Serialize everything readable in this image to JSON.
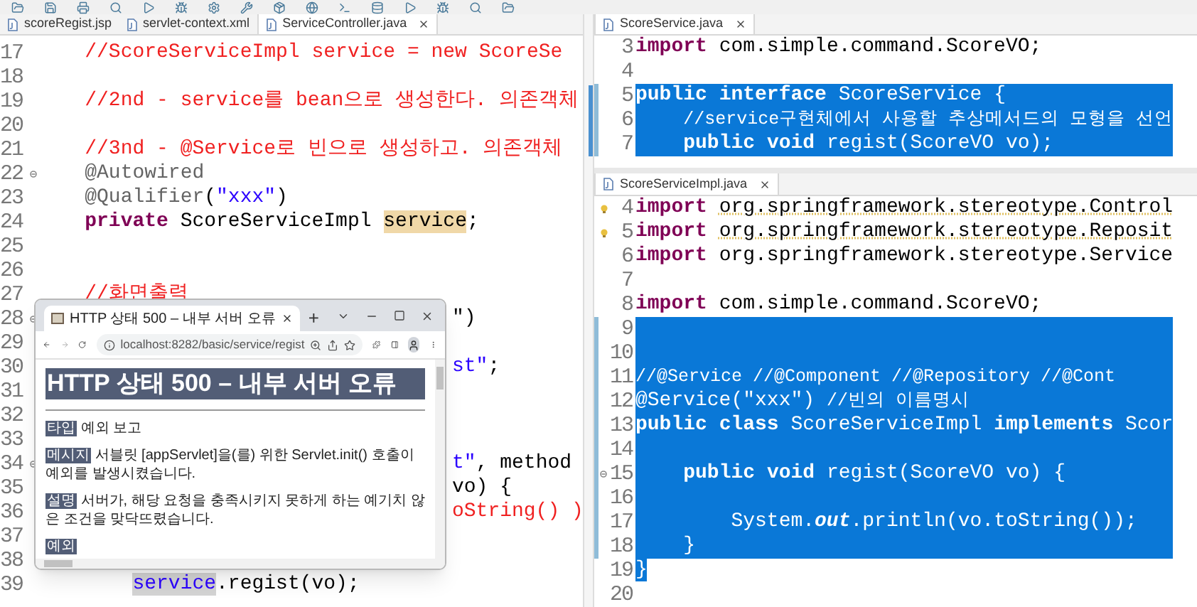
{
  "left_editor": {
    "tabs": [
      {
        "label": "scoreRegist.jsp",
        "selected": false
      },
      {
        "label": "servlet-context.xml",
        "selected": false
      },
      {
        "label": "ServiceController.java",
        "selected": true
      }
    ],
    "lines": [
      {
        "number": "17",
        "kind": "code",
        "occluded": false,
        "segments": [
          {
            "kind": "comment",
            "text": "    //ScoreServiceImpl service = new ScoreSe"
          }
        ]
      },
      {
        "number": "18",
        "kind": "code"
      },
      {
        "number": "19",
        "kind": "code",
        "occluded": false,
        "segments": [
          {
            "kind": "comment",
            "text": "    //2nd - service를 bean으로 생성한다. 의존객체"
          }
        ]
      },
      {
        "number": "20",
        "kind": "code"
      },
      {
        "number": "21",
        "kind": "code",
        "occluded": false,
        "segments": [
          {
            "kind": "comment",
            "text": "    //3nd - @Service로 빈으로 생성하고. 의존객체"
          }
        ]
      },
      {
        "number": "22",
        "kind": "fold",
        "occluded": false,
        "segments": [
          {
            "kind": "annotation",
            "text": "    @Autowired"
          }
        ]
      },
      {
        "number": "23",
        "kind": "code",
        "occluded": false,
        "segments": [
          {
            "kind": "annotation",
            "text": "    @Qualifier"
          },
          {
            "kind": "plain",
            "text": "("
          },
          {
            "kind": "string",
            "text": "\"xxx\""
          },
          {
            "kind": "plain",
            "text": ")"
          }
        ]
      },
      {
        "number": "24",
        "kind": "code",
        "occluded": false,
        "segments": [
          {
            "kind": "keyword",
            "text": "    private"
          },
          {
            "kind": "plain",
            "text": " ScoreServiceImpl "
          },
          {
            "kind": "occurrence",
            "text": "service"
          },
          {
            "kind": "plain",
            "text": ";"
          }
        ]
      },
      {
        "number": "25",
        "kind": "code"
      },
      {
        "number": "26",
        "kind": "code"
      },
      {
        "number": "27",
        "kind": "code",
        "occluded": false,
        "segments": [
          {
            "kind": "comment",
            "text": "    //화면출력"
          }
        ]
      },
      {
        "number": "28",
        "kind": "fold",
        "occluded": true,
        "segments": [
          {
            "kind": "plain",
            "text": "\")"
          }
        ]
      },
      {
        "number": "29",
        "kind": "code"
      },
      {
        "number": "30",
        "kind": "code",
        "occluded": true,
        "segments": [
          {
            "kind": "string",
            "text": "st\""
          },
          {
            "kind": "plain",
            "text": ";"
          }
        ]
      },
      {
        "number": "31",
        "kind": "code"
      },
      {
        "number": "32",
        "kind": "code"
      },
      {
        "number": "33",
        "kind": "code"
      },
      {
        "number": "34",
        "kind": "fold",
        "occluded": true,
        "segments": [
          {
            "kind": "string",
            "text": "t\""
          },
          {
            "kind": "plain",
            "text": ", method"
          }
        ]
      },
      {
        "number": "35",
        "kind": "code",
        "occluded": true,
        "segments": [
          {
            "kind": "plain",
            "text": "vo) {"
          }
        ]
      },
      {
        "number": "36",
        "kind": "code",
        "occluded": true,
        "segments": [
          {
            "kind": "comment",
            "text": "oString() )"
          }
        ]
      },
      {
        "number": "37",
        "kind": "code"
      },
      {
        "number": "38",
        "kind": "code"
      },
      {
        "number": "39",
        "kind": "code",
        "occluded": false,
        "segments": [
          {
            "kind": "reference",
            "text": "        service"
          },
          {
            "kind": "plain",
            "text": ".regist(vo);"
          }
        ]
      }
    ]
  },
  "right_top": {
    "tabs": [
      {
        "label": "ScoreService.java",
        "selected": true
      }
    ],
    "lines": [
      {
        "number": "3",
        "selected": false,
        "segments": [
          {
            "kind": "keyword",
            "text": "import"
          },
          {
            "kind": "plain",
            "text": " com.simple.command.ScoreVO;"
          }
        ]
      },
      {
        "number": "4",
        "selected": false
      },
      {
        "number": "5",
        "selected": true,
        "segments": [
          {
            "kind": "keyword",
            "text": "public"
          },
          {
            "kind": "keyword",
            "text": " interface"
          },
          {
            "kind": "plain",
            "text": " ScoreService {"
          }
        ]
      },
      {
        "number": "6",
        "selected": true,
        "segments": [
          {
            "kind": "comment",
            "text": "    //service구현체에서 사용할 추상메서드의 모형을 선언"
          }
        ]
      },
      {
        "number": "7",
        "selected": true,
        "segments": [
          {
            "kind": "keyword",
            "text": "    public"
          },
          {
            "kind": "keyword",
            "text": " void"
          },
          {
            "kind": "plain",
            "text": " regist(ScoreVO vo);"
          }
        ]
      }
    ]
  },
  "right_bottom": {
    "tabs": [
      {
        "label": "ScoreServiceImpl.java",
        "selected": true
      }
    ],
    "lines": [
      {
        "number": "4",
        "kind": "warning",
        "selected": false,
        "segments": [
          {
            "kind": "keyword",
            "text": "import"
          },
          {
            "kind": "warning",
            "text": " org.springframework.stereotype.Control"
          }
        ]
      },
      {
        "number": "5",
        "kind": "warning",
        "selected": false,
        "segments": [
          {
            "kind": "keyword",
            "text": "import"
          },
          {
            "kind": "warning",
            "text": " org.springframework.stereotype.Reposit"
          }
        ]
      },
      {
        "number": "6",
        "kind": "code",
        "selected": false,
        "segments": [
          {
            "kind": "keyword",
            "text": "import"
          },
          {
            "kind": "plain",
            "text": " org.springframework.stereotype.Service"
          }
        ]
      },
      {
        "number": "7",
        "kind": "code",
        "selected": false
      },
      {
        "number": "8",
        "kind": "code",
        "selected": false,
        "segments": [
          {
            "kind": "keyword",
            "text": "import"
          },
          {
            "kind": "plain",
            "text": " com.simple.command.ScoreVO;"
          }
        ]
      },
      {
        "number": "9",
        "kind": "code",
        "selected": true
      },
      {
        "number": "10",
        "kind": "code",
        "selected": true
      },
      {
        "number": "11",
        "kind": "code",
        "selected": true,
        "segments": [
          {
            "kind": "comment",
            "text": "//@Service //@Component //@Repository //@Cont"
          }
        ]
      },
      {
        "number": "12",
        "kind": "code",
        "selected": true,
        "segments": [
          {
            "kind": "annotation",
            "text": "@Service"
          },
          {
            "kind": "plain",
            "text": "("
          },
          {
            "kind": "string",
            "text": "\"xxx\""
          },
          {
            "kind": "plain",
            "text": ")"
          },
          {
            "kind": "comment",
            "text": " //빈의 이름명시"
          }
        ]
      },
      {
        "number": "13",
        "kind": "code",
        "selected": true,
        "segments": [
          {
            "kind": "keyword",
            "text": "public"
          },
          {
            "kind": "keyword",
            "text": " class"
          },
          {
            "kind": "plain",
            "text": " ScoreServiceImpl "
          },
          {
            "kind": "keyword",
            "text": "implements"
          },
          {
            "kind": "plain",
            "text": " Scor"
          }
        ]
      },
      {
        "number": "14",
        "kind": "code",
        "selected": true
      },
      {
        "number": "15",
        "kind": "fold",
        "selected": true,
        "segments": [
          {
            "kind": "keyword",
            "text": "    public"
          },
          {
            "kind": "keyword",
            "text": " void"
          },
          {
            "kind": "plain",
            "text": " regist(ScoreVO vo) {"
          }
        ]
      },
      {
        "number": "16",
        "kind": "code",
        "selected": true
      },
      {
        "number": "17",
        "kind": "code",
        "selected": true,
        "segments": [
          {
            "kind": "plain",
            "text": "        System."
          },
          {
            "kind": "field",
            "text": "out"
          },
          {
            "kind": "plain",
            "text": ".println(vo.toString());"
          }
        ]
      },
      {
        "number": "18",
        "kind": "code",
        "selected": true,
        "segments": [
          {
            "kind": "plain",
            "text": "    }"
          }
        ]
      },
      {
        "number": "19",
        "kind": "code",
        "selected": false,
        "segments": [
          {
            "kind": "selected",
            "text": "}"
          }
        ]
      },
      {
        "number": "20",
        "kind": "code",
        "selected": false
      }
    ]
  },
  "browser": {
    "tab_title": "HTTP 상태 500 – 내부 서버 오류",
    "new_tab": "+",
    "url": "localhost:8282/basic/service/regist",
    "heading": "HTTP 상태 500 – 내부 서버 오류",
    "entries": [
      {
        "label": "타입",
        "text": "예외 보고"
      },
      {
        "label": "메시지",
        "text": "서블릿 [appServlet]을(를) 위한 Servlet.init() 호출이 예외를 발생시켰습니다."
      },
      {
        "label": "설명",
        "text": "서버가, 해당 요청을 충족시키지 못하게 하는 예기치 않은 조건을 맞닥뜨렸습니다."
      },
      {
        "label": "예외"
      }
    ]
  }
}
